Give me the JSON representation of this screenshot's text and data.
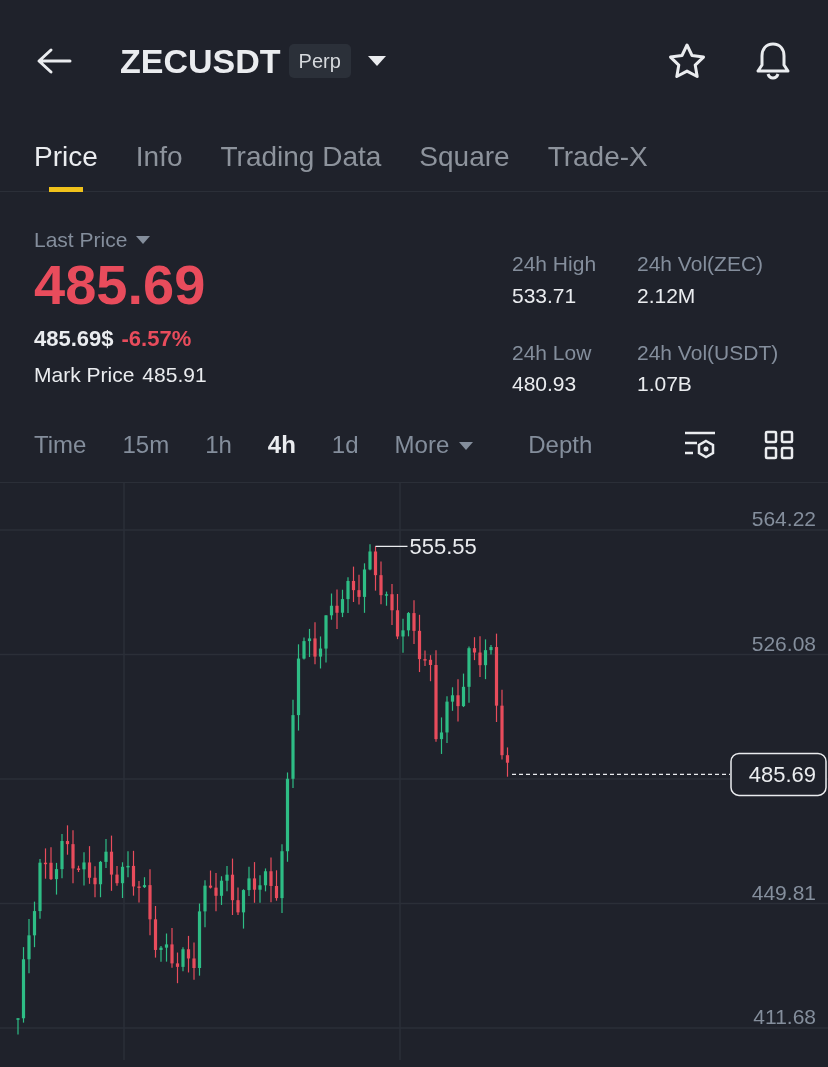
{
  "header": {
    "symbol": "ZECUSDT",
    "badge": "Perp"
  },
  "tabs": [
    {
      "label": "Price",
      "selected": true
    },
    {
      "label": "Info",
      "selected": false
    },
    {
      "label": "Trading Data",
      "selected": false
    },
    {
      "label": "Square",
      "selected": false
    },
    {
      "label": "Trade-X",
      "selected": false
    }
  ],
  "price": {
    "label": "Last Price",
    "last": "485.69",
    "usd": "485.69$",
    "change": "-6.57%",
    "mark_label": "Mark Price",
    "mark": "485.91"
  },
  "stats": [
    {
      "label": "24h High",
      "value": "533.71"
    },
    {
      "label": "24h Vol(ZEC)",
      "value": "2.12M"
    },
    {
      "label": "24h Low",
      "value": "480.93"
    },
    {
      "label": "24h Vol(USDT)",
      "value": "1.07B"
    }
  ],
  "intervals": [
    {
      "label": "Time",
      "selected": false,
      "kind": "plain"
    },
    {
      "label": "15m",
      "selected": false,
      "kind": "plain"
    },
    {
      "label": "1h",
      "selected": false,
      "kind": "plain"
    },
    {
      "label": "4h",
      "selected": true,
      "kind": "plain"
    },
    {
      "label": "1d",
      "selected": false,
      "kind": "plain"
    },
    {
      "label": "More",
      "selected": false,
      "kind": "dropdown"
    },
    {
      "label": "Depth",
      "selected": false,
      "kind": "plain"
    }
  ],
  "chart": {
    "y_labels": [
      "564.22",
      "526.08",
      "449.81",
      "411.68"
    ],
    "high_label": "555.55",
    "current_price": "485.69"
  }
}
